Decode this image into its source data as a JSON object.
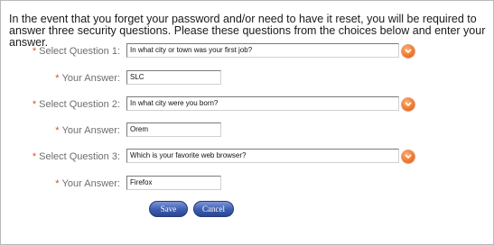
{
  "intro_text": "In the event that you forget your password and/or need to have it reset, you will be required to answer three security questions. Please these questions from the choices below and enter your answer.",
  "required_marker": "*",
  "questions": [
    {
      "select_label": "Select Question 1:",
      "selected_question": "In what city or town was your first job?",
      "answer_label": "Your Answer:",
      "answer_value": "SLC"
    },
    {
      "select_label": "Select Question 2:",
      "selected_question": "In what city were you born?",
      "answer_label": "Your Answer:",
      "answer_value": "Orem"
    },
    {
      "select_label": "Select Question 3:",
      "selected_question": "Which is your favorite web browser?",
      "answer_label": "Your Answer:",
      "answer_value": "Firefox"
    }
  ],
  "buttons": {
    "save_label": "Save",
    "cancel_label": "Cancel"
  },
  "colors": {
    "required_marker": "#d2551f",
    "label_text": "#6e6e6e",
    "dropdown_button": "#f3792d",
    "button_blue": "#3c5cb0"
  },
  "icons": {
    "dropdown": "chevron-down-icon"
  }
}
